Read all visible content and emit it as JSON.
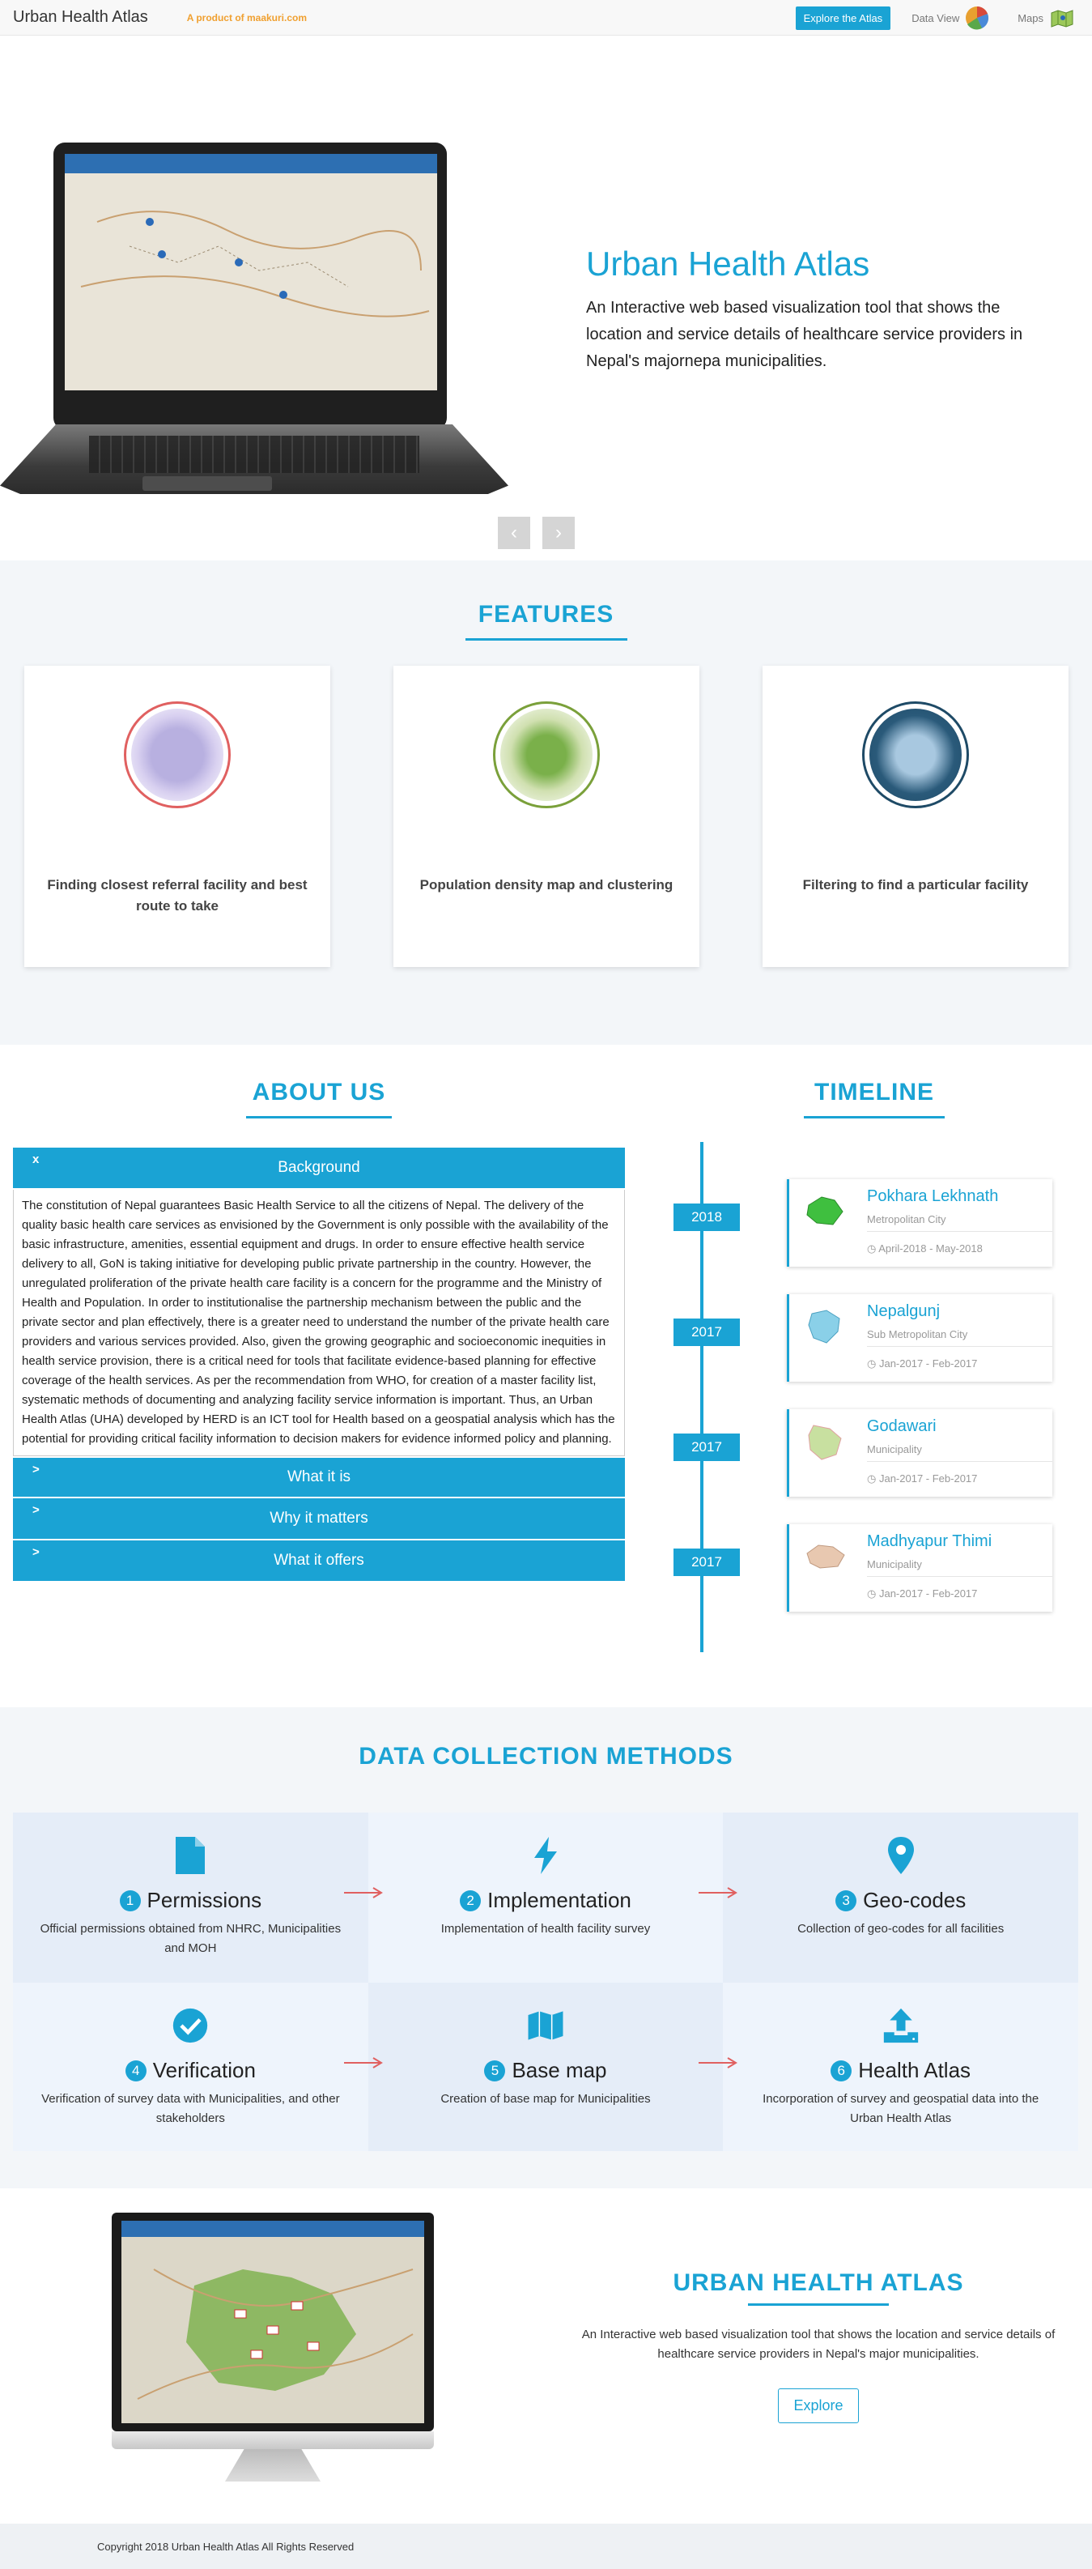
{
  "nav": {
    "brand": "Urban Health Atlas",
    "product": "A product of maakuri.com",
    "explore_label": "Explore the Atlas",
    "data_view_label": "Data View",
    "maps_label": "Maps",
    "icons": [
      "pie-chart-icon",
      "map-flag-icon"
    ]
  },
  "hero": {
    "title": "Urban Health Atlas",
    "description": "An Interactive web based visualization tool that shows the location and service details of healthcare service providers in Nepal's majornepa municipalities.",
    "prev_symbol": "‹",
    "next_symbol": "›"
  },
  "features": {
    "title": "FEATURES",
    "cards": [
      {
        "text": "Finding closest referral facility and best route to take",
        "color": "#e06060"
      },
      {
        "text": "Population density map and clustering",
        "color": "#7aa03a"
      },
      {
        "text": "Filtering to find a particular facility",
        "color": "#1e4a66"
      }
    ]
  },
  "about": {
    "title": "ABOUT US",
    "sections": [
      {
        "symbol": "x",
        "label": "Background",
        "open": true,
        "body": "The constitution of Nepal guarantees Basic Health Service to all the citizens of Nepal. The delivery of the quality basic health care services as envisioned by the Government is only possible with the availability of the basic infrastructure, amenities, essential equipment and drugs. In order to ensure effective health service delivery to all, GoN is taking initiative for developing public private partnership in the country. However, the unregulated proliferation of the private health care facility is a concern for the programme and the Ministry of Health and Population. In order to institutionalise the partnership mechanism between the public and the private sector and plan effectively, there is a greater need to understand the number of the private health care providers and various services provided. Also, given the growing geographic and socioeconomic inequities in health service provision, there is a critical need for tools that facilitate evidence-based planning for effective coverage of the health services. As per the recommendation from WHO, for creation of a master facility list, systematic methods of documenting and analyzing facility service information is important. Thus, an Urban Health Atlas (UHA) developed by HERD is an ICT tool for Health based on a geospatial analysis which has the potential for providing critical facility information to decision makers for evidence informed policy and planning."
      },
      {
        "symbol": ">",
        "label": "What it is",
        "open": false
      },
      {
        "symbol": ">",
        "label": "Why it matters",
        "open": false
      },
      {
        "symbol": ">",
        "label": "What it offers",
        "open": false
      }
    ]
  },
  "timeline": {
    "title": "TIMELINE",
    "items": [
      {
        "year": "2018",
        "name": "Pokhara Lekhnath",
        "type": "Metropolitan City",
        "date": "April-2018 - May-2018",
        "map_color": "#3fbf3f"
      },
      {
        "year": "2017",
        "name": "Nepalgunj",
        "type": "Sub Metropolitan City",
        "date": "Jan-2017 - Feb-2017",
        "map_color": "#8ad0e8"
      },
      {
        "year": "2017",
        "name": "Godawari",
        "type": "Municipality",
        "date": "Jan-2017 - Feb-2017",
        "map_color": "#c8e0a0"
      },
      {
        "year": "2017",
        "name": "Madhyapur Thimi",
        "type": "Municipality",
        "date": "Jan-2017 - Feb-2017",
        "map_color": "#e8c8b0"
      }
    ]
  },
  "dcm": {
    "title": "DATA COLLECTION METHODS",
    "steps": [
      {
        "num": "1",
        "title": "Permissions",
        "desc": "Official permissions obtained from NHRC, Municipalities and MOH",
        "icon": "file-icon"
      },
      {
        "num": "2",
        "title": "Implementation",
        "desc": "Implementation of health facility survey",
        "icon": "bolt-icon"
      },
      {
        "num": "3",
        "title": "Geo-codes",
        "desc": "Collection of geo-codes for all facilities",
        "icon": "map-pin-icon"
      },
      {
        "num": "4",
        "title": "Verification",
        "desc": "Verification of survey data with Municipalities, and other stakeholders",
        "icon": "check-circle-icon"
      },
      {
        "num": "5",
        "title": "Base map",
        "desc": "Creation of base map for Municipalities",
        "icon": "map-icon"
      },
      {
        "num": "6",
        "title": "Health Atlas",
        "desc": "Incorporation of survey and geospatial data into the Urban Health Atlas",
        "icon": "upload-icon"
      }
    ]
  },
  "bottom": {
    "title": "URBAN HEALTH ATLAS",
    "description": "An Interactive web based visualization tool that shows the location and service details of healthcare service providers in Nepal's major municipalities.",
    "explore_label": "Explore"
  },
  "footer": {
    "copyright": "Copyright 2018 Urban Health Atlas All Rights Reserved"
  },
  "colors": {
    "accent": "#1aa3d4",
    "product": "#f0a030"
  }
}
